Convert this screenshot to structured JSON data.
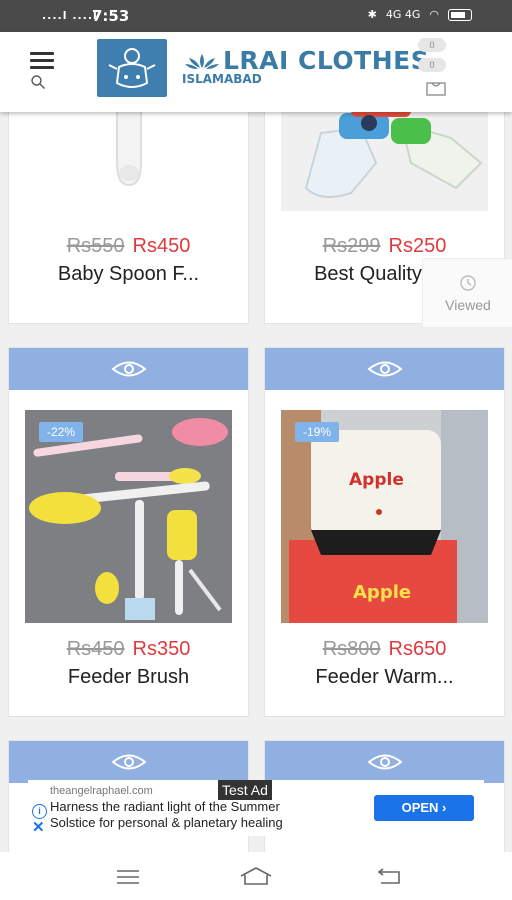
{
  "status": {
    "time": "7:53",
    "signal": "....l ....l",
    "network": "4G 4G",
    "icons": [
      "bluetooth-icon",
      "wifi-icon",
      "battery-icon"
    ]
  },
  "header": {
    "brand_name": "LRAI CLOTHES",
    "brand_sub": "ISLAMABAD",
    "wishlist_count": "0",
    "cart_count": "0",
    "accent": "#3a7ca5"
  },
  "products": [
    {
      "old_price": "Rs550",
      "new_price": "Rs450",
      "name": "Baby Spoon F...",
      "discount": ""
    },
    {
      "old_price": "Rs299",
      "new_price": "Rs250",
      "name": "Best Quality P...",
      "discount": ""
    },
    {
      "old_price": "Rs450",
      "new_price": "Rs350",
      "name": "Feeder Brush",
      "discount": "-22%"
    },
    {
      "old_price": "Rs800",
      "new_price": "Rs650",
      "name": "Feeder Warm...",
      "discount": "-19%",
      "image_text": "Apple"
    }
  ],
  "viewed": {
    "label": "Viewed"
  },
  "ad": {
    "badge": "Test Ad",
    "domain": "theangelraphael.com",
    "line1": "Harness the radiant light of the Summer",
    "line2": "Solstice for personal & planetary healing",
    "cta": "OPEN"
  },
  "colors": {
    "eye_bar": "#8fb0e0",
    "price_new": "#e0393e",
    "ad_button": "#1a73e8"
  }
}
